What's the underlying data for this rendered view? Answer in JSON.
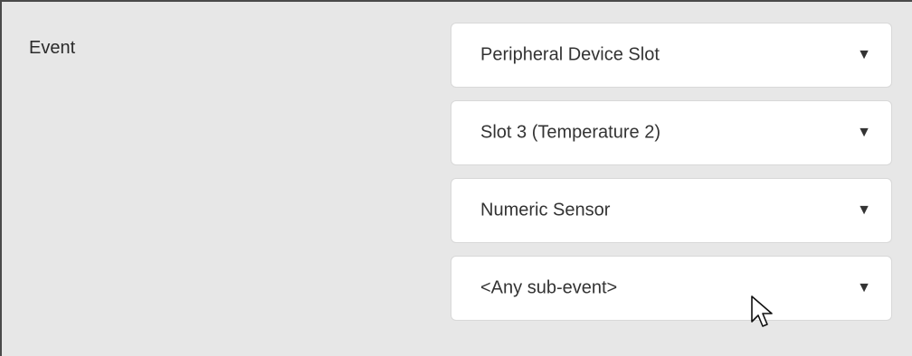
{
  "event": {
    "label": "Event"
  },
  "selects": [
    {
      "value": "Peripheral Device Slot",
      "arrow_icon": "triangle-down-icon"
    },
    {
      "value": "Slot 3 (Temperature 2)",
      "arrow_icon": "triangle-down-icon"
    },
    {
      "value": "Numeric Sensor",
      "arrow_icon": "triangle-down-icon"
    },
    {
      "value": "<Any sub-event>",
      "arrow_icon": "triangle-down-icon"
    }
  ],
  "icons": {
    "arrow_glyph": "▼",
    "cursor": "mouse-pointer-icon"
  },
  "colors": {
    "panel_background": "#e7e7e7",
    "select_background": "#ffffff",
    "text": "#333333",
    "frame_border": "#4a4a4a"
  }
}
